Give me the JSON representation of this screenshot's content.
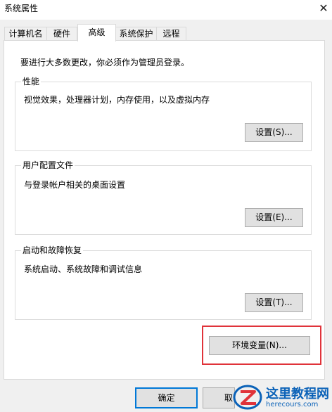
{
  "window": {
    "title": "系统属性",
    "close_icon": "close-icon"
  },
  "tabs": [
    {
      "label": "计算机名"
    },
    {
      "label": "硬件"
    },
    {
      "label": "高级",
      "active": true
    },
    {
      "label": "系统保护"
    },
    {
      "label": "远程"
    }
  ],
  "notice": "要进行大多数更改，你必须作为管理员登录。",
  "performance": {
    "title": "性能",
    "description": "视觉效果，处理器计划，内存使用，以及虚拟内存",
    "button": "设置(S)..."
  },
  "user_profiles": {
    "title": "用户配置文件",
    "description": "与登录帐户相关的桌面设置",
    "button": "设置(E)..."
  },
  "startup_recovery": {
    "title": "启动和故障恢复",
    "description": "系统启动、系统故障和调试信息",
    "button": "设置(T)..."
  },
  "env_button": "环境变量(N)...",
  "footer": {
    "ok": "确定",
    "cancel": "取"
  },
  "watermark": {
    "title": "这里教程网",
    "url": "herecours.com"
  },
  "colors": {
    "highlight": "#e0333a",
    "accent": "#0078d7",
    "watermark": "#0b62b8"
  }
}
